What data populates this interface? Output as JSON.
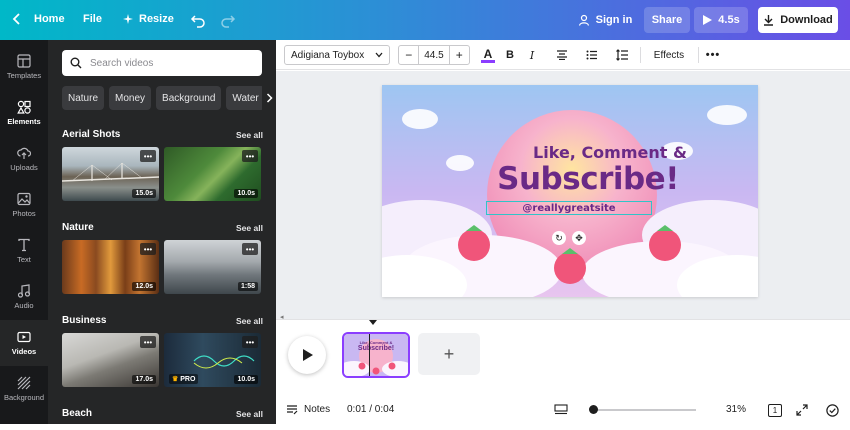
{
  "topbar": {
    "home_label": "Home",
    "file_label": "File",
    "resize_label": "Resize",
    "signin_label": "Sign in",
    "share_label": "Share",
    "play_duration": "4.5s",
    "download_label": "Download"
  },
  "rail": {
    "items": [
      {
        "label": "Templates",
        "icon": "templates-icon"
      },
      {
        "label": "Elements",
        "icon": "elements-icon"
      },
      {
        "label": "Uploads",
        "icon": "upload-icon"
      },
      {
        "label": "Photos",
        "icon": "photos-icon"
      },
      {
        "label": "Text",
        "icon": "text-icon"
      },
      {
        "label": "Audio",
        "icon": "audio-icon"
      },
      {
        "label": "Videos",
        "icon": "videos-icon"
      },
      {
        "label": "Background",
        "icon": "background-icon"
      }
    ],
    "active": "Videos"
  },
  "panel": {
    "search_placeholder": "Search videos",
    "chips": [
      "Nature",
      "Money",
      "Background",
      "Water"
    ],
    "see_all": "See all",
    "sections": [
      {
        "title": "Aerial Shots",
        "durations": [
          "15.0s",
          "10.0s"
        ]
      },
      {
        "title": "Nature",
        "durations": [
          "12.0s",
          "1:58"
        ]
      },
      {
        "title": "Business",
        "durations": [
          "17.0s",
          "10.0s"
        ],
        "badge": "PRO"
      },
      {
        "title": "Beach",
        "durations": []
      }
    ]
  },
  "toolbar": {
    "font_name": "Adigiana Toybox",
    "font_size": "44.5",
    "effects_label": "Effects",
    "text_color": "#8b3dff"
  },
  "design": {
    "line1": "Like, Comment &",
    "line2": "Subscribe!",
    "handle": "@reallygreatsite"
  },
  "timeline": {
    "clip_line1": "Like, Comment &",
    "clip_line2": "Subscribe!"
  },
  "footer": {
    "notes_label": "Notes",
    "time": "0:01 / 0:04",
    "zoom": "31%",
    "page_count": "1"
  },
  "colors": {
    "accent": "#8b3dff",
    "title_purple": "#6a2a86",
    "panel_bg": "#252627",
    "rail_bg": "#18191b"
  }
}
